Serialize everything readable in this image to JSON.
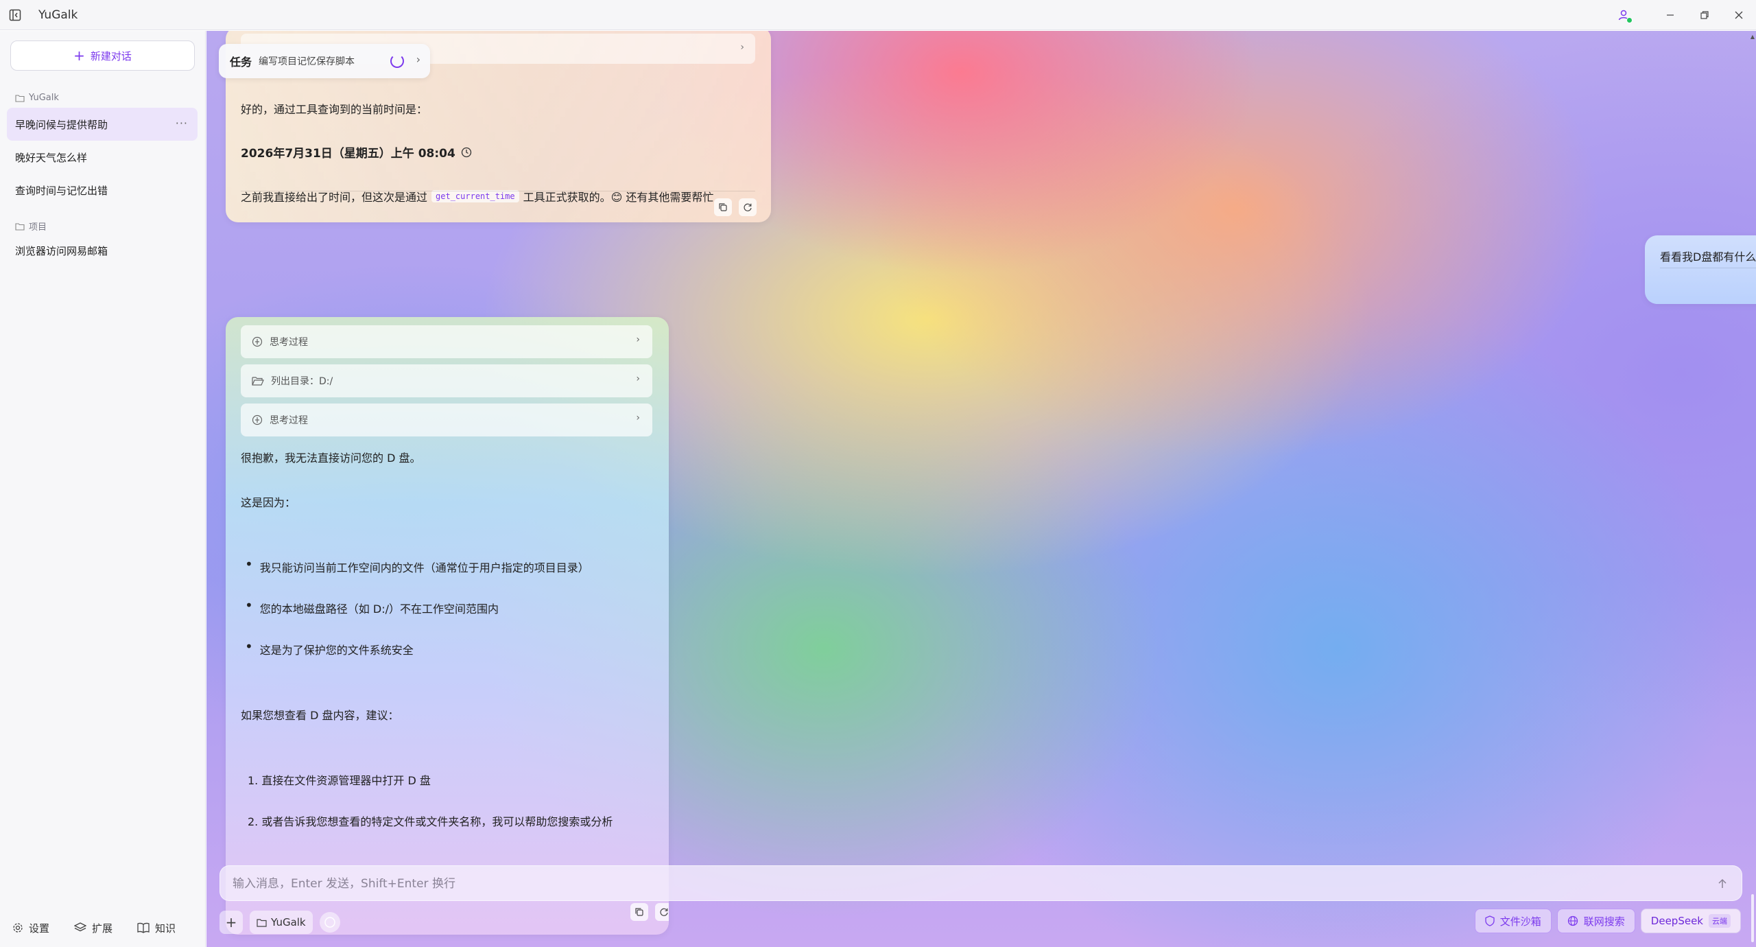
{
  "window": {
    "title": "YuGalk"
  },
  "sidebar": {
    "new_chat_label": "新建对话",
    "groups": [
      {
        "label": "YuGalk",
        "items": [
          "早晚问候与提供帮助",
          "晚好天气怎么样",
          "查询时间与记忆出错"
        ]
      },
      {
        "label": "项目",
        "items": [
          "浏览器访问网易邮箱"
        ]
      }
    ],
    "active_item_more": "···",
    "footer": {
      "settings": "设置",
      "extensions": "扩展",
      "knowledge": "知识"
    }
  },
  "task_popup": {
    "tag": "任务",
    "description": "编写项目记忆保存脚本"
  },
  "messages": {
    "assistant_1": {
      "intro": "好的，通过工具查询到的当前时间是：",
      "time": "2026年7月31日（星期五）上午 08:04",
      "outro_before": "之前我直接给出了时间，但这次是通过",
      "outro_code": "get_current_time",
      "outro_after": "工具正式获取的。😊 还有其他需要帮忙"
    },
    "user_1": {
      "text": "看看我D盘都有什么文件夹"
    },
    "assistant_2": {
      "steps": [
        "思考过程",
        "列出目录：D:/",
        "思考过程"
      ],
      "p1": "很抱歉，我无法直接访问您的 D 盘。",
      "p2": "这是因为：",
      "bullets": [
        "我只能访问当前工作空间内的文件（通常位于用户指定的项目目录）",
        "您的本地磁盘路径（如 D:/）不在工作空间范围内",
        "这是为了保护您的文件系统安全"
      ],
      "p3": "如果您想查看 D 盘内容，建议：",
      "numbered": [
        "1. 直接在文件资源管理器中打开 D 盘",
        "2. 或者告诉我您想查看的特定文件或文件夹名称，我可以帮助您搜索或分析"
      ]
    }
  },
  "composer": {
    "placeholder": "输入消息，Enter 发送，Shift+Enter 换行",
    "workspace": "YuGalk",
    "sandbox": "文件沙箱",
    "web_search": "联网搜索",
    "model": "DeepSeek",
    "model_badge": "云端"
  },
  "colors": {
    "accent": "#7c3aed",
    "online": "#22c55e"
  }
}
